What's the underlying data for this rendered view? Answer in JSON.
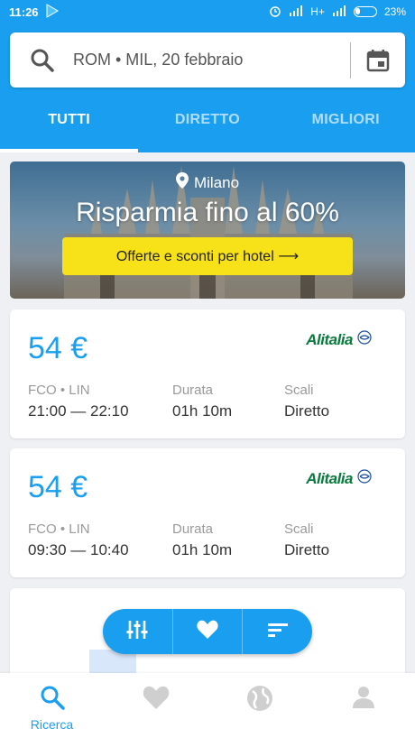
{
  "status_bar": {
    "time": "11:26",
    "network": "H+",
    "battery": "23%"
  },
  "search": {
    "query": "ROM • MIL, 20 febbraio"
  },
  "tabs": [
    {
      "label": "TUTTI",
      "active": true
    },
    {
      "label": "DIRETTO",
      "active": false
    },
    {
      "label": "MIGLIORI",
      "active": false
    }
  ],
  "promo": {
    "city": "Milano",
    "title": "Risparmia fino al 60%",
    "button_label": "Offerte e sconti per hotel ⟶"
  },
  "flights": [
    {
      "price": "54 €",
      "airline": "Alitalia",
      "route": "FCO • LIN",
      "times": "21:00 — 22:10",
      "duration_label": "Durata",
      "duration": "01h 10m",
      "stops_label": "Scali",
      "stops": "Diretto"
    },
    {
      "price": "54 €",
      "airline": "Alitalia",
      "route": "FCO • LIN",
      "times": "09:30 — 10:40",
      "duration_label": "Durata",
      "duration": "01h 10m",
      "stops_label": "Scali",
      "stops": "Diretto"
    }
  ],
  "fab_actions": [
    {
      "icon": "filter-sliders-icon"
    },
    {
      "icon": "heart-icon"
    },
    {
      "icon": "sort-icon"
    }
  ],
  "bottom_nav": [
    {
      "icon": "search-icon",
      "label": "Ricerca",
      "active": true
    },
    {
      "icon": "heart-icon",
      "label": "",
      "active": false
    },
    {
      "icon": "globe-icon",
      "label": "",
      "active": false
    },
    {
      "icon": "person-icon",
      "label": "",
      "active": false
    }
  ],
  "colors": {
    "accent": "#1a9ff0",
    "promo_button": "#f7e21a",
    "airline_green": "#0a7a3e"
  }
}
